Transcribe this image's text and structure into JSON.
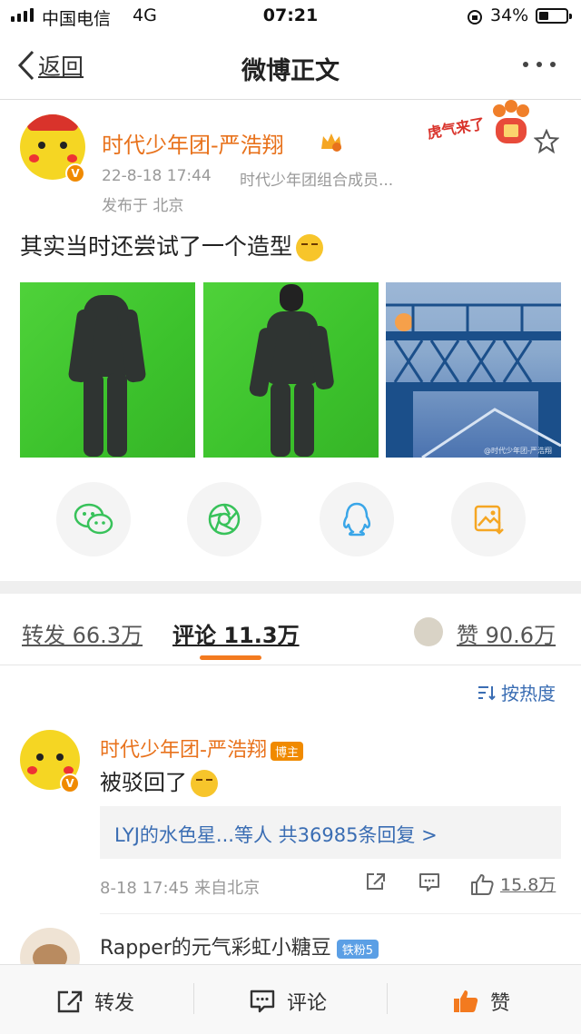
{
  "status_bar": {
    "carrier": "中国电信",
    "network": "4G",
    "time": "07:21",
    "battery": "34%",
    "battery_level": 0.34
  },
  "nav": {
    "back_label": "返回",
    "title": "微博正文"
  },
  "post": {
    "author": "时代少年团-严浩翔",
    "time": "22-8-18 17:44",
    "source": "时代少年团组合成员...",
    "location": "发布于 北京",
    "sticker_text": "虎气来了",
    "text": "其实当时还尝试了一个造型",
    "watermark": "@时代少年团-严浩翔",
    "verified_mark": "V"
  },
  "share": {
    "icons": [
      "wechat-icon",
      "moments-icon",
      "qq-icon",
      "save-image-icon"
    ]
  },
  "tabs": {
    "repost": "转发 66.3万",
    "comment": "评论 11.3万",
    "like": "赞 90.6万"
  },
  "sort": {
    "label": "按热度"
  },
  "comments": [
    {
      "author": "时代少年团-严浩翔",
      "badge": "博主",
      "text": "被驳回了",
      "replies": "LYJ的水色星...等人  共36985条回复 >",
      "time": "8-18 17:45 来自北京",
      "likes": "15.8万"
    },
    {
      "author": "Rapper的元气彩虹小糖豆",
      "badge": "铁粉5"
    }
  ],
  "bottom_bar": {
    "repost": "转发",
    "comment": "评论",
    "like": "赞"
  },
  "colors": {
    "accent": "#f37a1f",
    "link": "#3a6db3",
    "username": "#e8721c"
  }
}
